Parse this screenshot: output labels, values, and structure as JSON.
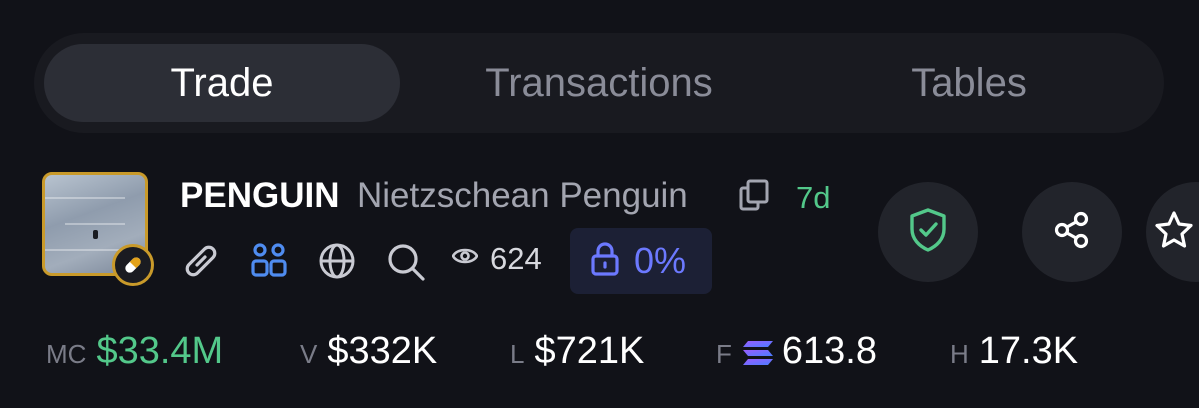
{
  "tabs": [
    {
      "label": "Trade",
      "active": true
    },
    {
      "label": "Transactions",
      "active": false
    },
    {
      "label": "Tables",
      "active": false
    }
  ],
  "token": {
    "ticker": "PENGUIN",
    "name": "Nietzschean Penguin",
    "age": "7d",
    "views": "624",
    "lock_percent": "0%"
  },
  "icons": {
    "link": "link-icon",
    "community": "community-icon",
    "website": "globe-icon",
    "search": "search-icon",
    "views": "eye-icon",
    "lock": "lock-icon",
    "copy": "copy-icon",
    "badge": "pill-icon",
    "shield": "shield-check-icon",
    "share": "share-icon",
    "star": "star-icon",
    "sol": "solana-icon"
  },
  "stats": {
    "mc": {
      "label": "MC",
      "value": "$33.4M"
    },
    "v": {
      "label": "V",
      "value": "$332K"
    },
    "l": {
      "label": "L",
      "value": "$721K"
    },
    "f": {
      "label": "F",
      "value": "613.8"
    },
    "h": {
      "label": "H",
      "value": "17.3K"
    }
  },
  "colors": {
    "background": "#111218",
    "accent_green": "#53c88a",
    "lock_blue": "#6c79ff",
    "badge_gold": "#c99a2a"
  }
}
